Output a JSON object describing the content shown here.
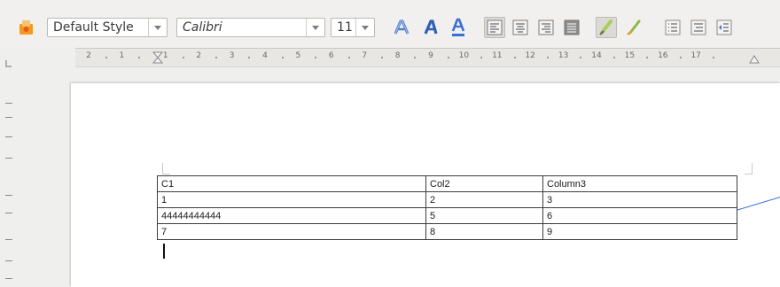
{
  "toolbar": {
    "paragraph_style": "Default Style",
    "font_name": "Calibri",
    "font_size": "11",
    "buttons": [
      {
        "name": "outline-font-effect-icon"
      },
      {
        "name": "shadow-font-icon"
      },
      {
        "name": "font-color-icon"
      },
      {
        "name": "align-left-icon"
      },
      {
        "name": "align-center-icon"
      },
      {
        "name": "align-right-icon"
      },
      {
        "name": "justify-icon"
      },
      {
        "name": "highlighting-color-icon"
      },
      {
        "name": "clear-formatting-icon"
      },
      {
        "name": "bullets-icon"
      },
      {
        "name": "numbering-icon"
      },
      {
        "name": "decrease-indent-icon"
      }
    ]
  },
  "ruler": {
    "numbers": [
      "2",
      "1",
      "1",
      "2",
      "3",
      "4",
      "5",
      "6",
      "7",
      "8",
      "9",
      "10",
      "11",
      "12",
      "13",
      "14",
      "15",
      "16",
      "17"
    ]
  },
  "document": {
    "table": {
      "rows": [
        [
          "C1",
          "Col2",
          "Column3"
        ],
        [
          "1",
          "2",
          "3"
        ],
        [
          "44444444444",
          "5",
          "6"
        ],
        [
          "7",
          "8",
          "9"
        ]
      ]
    }
  },
  "colors": {
    "background": "#efefee",
    "page": "#ffffff",
    "accent_blue": "#3b6fd4",
    "table_border": "#3c3c3c"
  }
}
